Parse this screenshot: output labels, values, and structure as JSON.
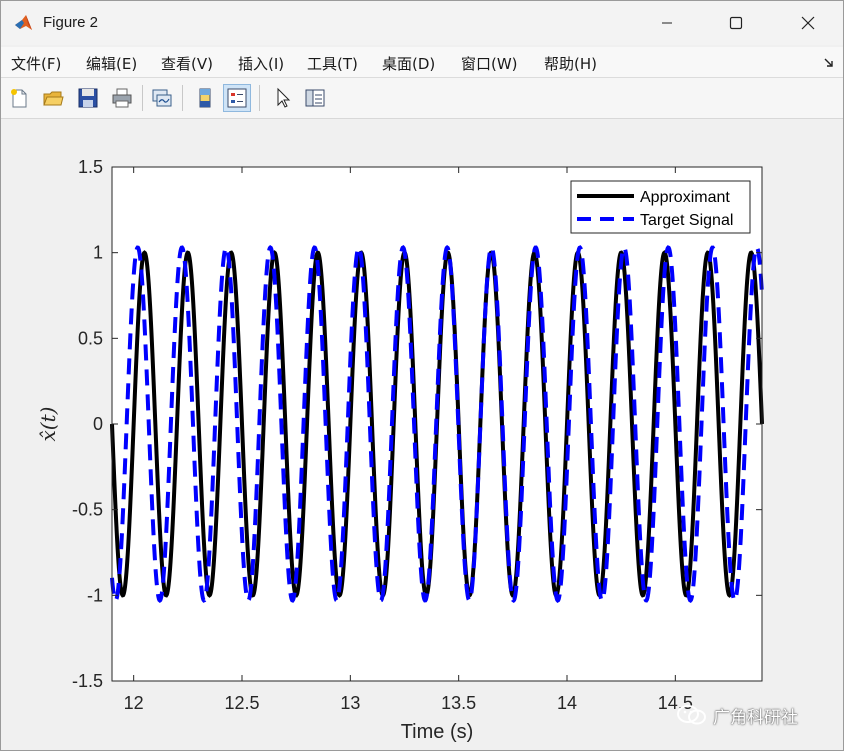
{
  "window": {
    "title": "Figure 2",
    "controls": [
      "minimize",
      "maximize",
      "close"
    ]
  },
  "menu": {
    "items": [
      "文件(F)",
      "编辑(E)",
      "查看(V)",
      "插入(I)",
      "工具(T)",
      "桌面(D)",
      "窗口(W)",
      "帮助(H)"
    ]
  },
  "toolbar": {
    "buttons": [
      "new-figure-icon",
      "open-file-icon",
      "save-icon",
      "print-icon",
      "link-plot-icon",
      "colorbar-icon",
      "legend-icon",
      "pointer-icon",
      "property-inspector-icon"
    ]
  },
  "chart_data": {
    "type": "line",
    "title": "",
    "xlabel": "Time (s)",
    "ylabel": "x̂(t)",
    "xlim": [
      11.9,
      14.9
    ],
    "ylim": [
      -1.5,
      1.5
    ],
    "xticks": [
      12,
      12.5,
      13,
      13.5,
      14,
      14.5
    ],
    "xtick_labels": [
      "12",
      "12.5",
      "13",
      "13.5",
      "14",
      "14.5"
    ],
    "yticks": [
      -1.5,
      -1,
      -0.5,
      0,
      0.5,
      1,
      1.5
    ],
    "ytick_labels": [
      "-1.5",
      "-1",
      "-0.5",
      "0",
      "0.5",
      "1",
      "1.5"
    ],
    "grid": false,
    "legend_position": "top-right",
    "series": [
      {
        "name": "Approximant",
        "color": "#000000",
        "style": "solid",
        "amplitude": 1.0,
        "frequency_hz": 5.0,
        "phase_rad": 3.1416
      },
      {
        "name": "Target Signal",
        "color": "#0000ff",
        "style": "dashed",
        "amplitude": 1.03,
        "frequency_hz": 4.9,
        "phase_rad": 4.2
      }
    ]
  },
  "watermark": {
    "text": "广角科研社"
  },
  "colors": {
    "axes_bg": "#ffffff",
    "figure_bg": "#f0f0f0",
    "approximant": "#000000",
    "target": "#0000ff"
  }
}
